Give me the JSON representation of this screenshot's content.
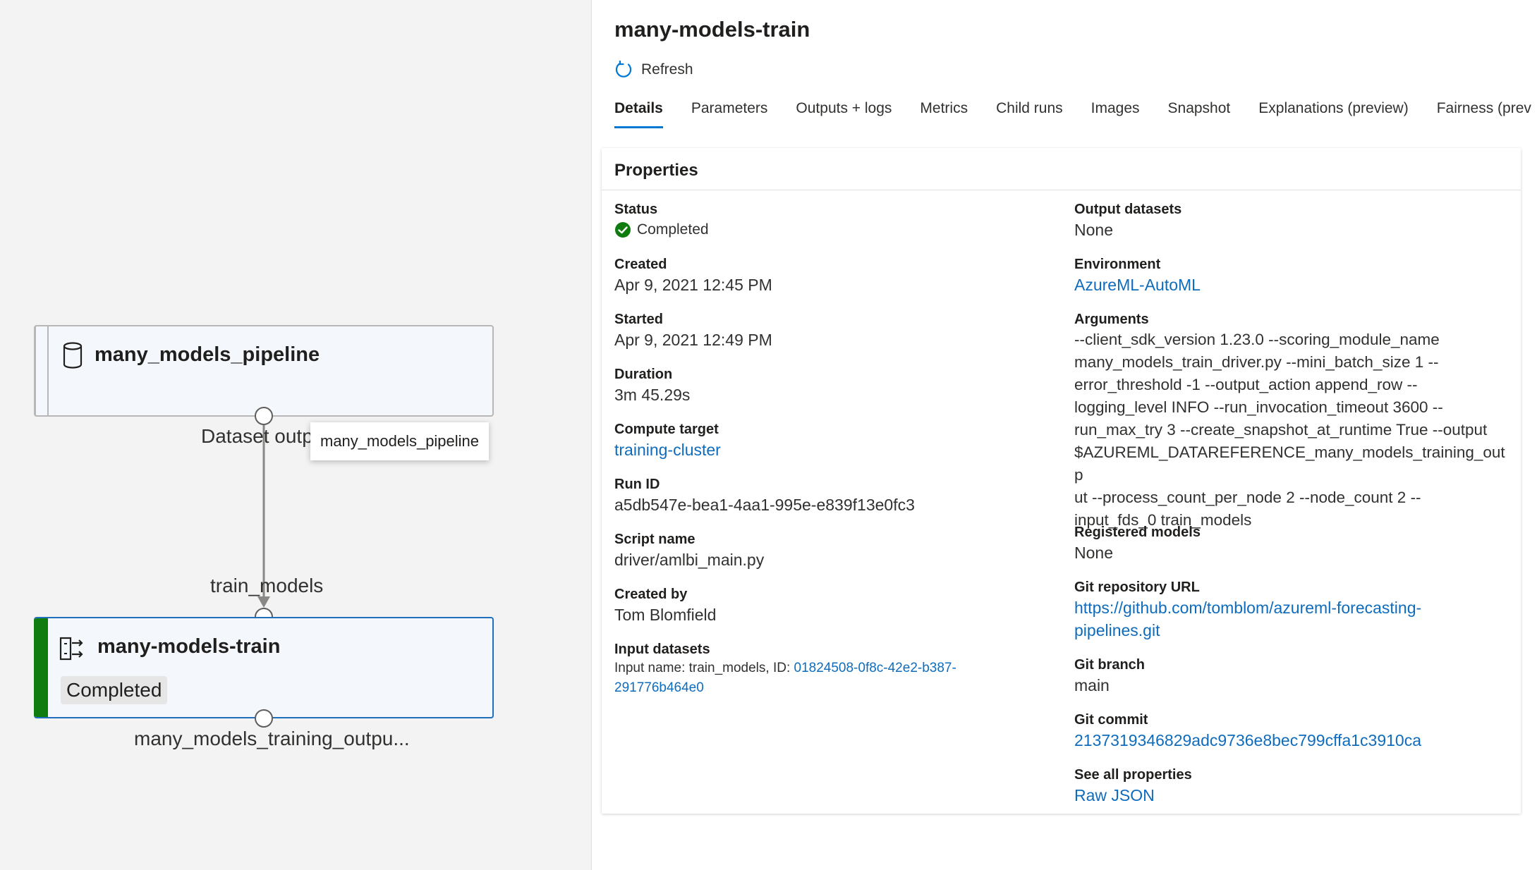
{
  "canvas": {
    "pipeline_node": {
      "title": "many_models_pipeline",
      "output_label": "Dataset outp"
    },
    "train_node": {
      "title": "many-models-train",
      "status": "Completed",
      "input_label": "train_models",
      "output_label": "many_models_training_outpu..."
    },
    "tooltip": "many_models_pipeline"
  },
  "panel": {
    "title": "many-models-train",
    "refresh_label": "Refresh",
    "tabs": [
      "Details",
      "Parameters",
      "Outputs + logs",
      "Metrics",
      "Child runs",
      "Images",
      "Snapshot",
      "Explanations (preview)",
      "Fairness (prev"
    ],
    "active_tab": "Details",
    "properties_title": "Properties",
    "left": {
      "status": {
        "label": "Status",
        "value": "Completed"
      },
      "created": {
        "label": "Created",
        "value": "Apr 9, 2021 12:45 PM"
      },
      "started": {
        "label": "Started",
        "value": "Apr 9, 2021 12:49 PM"
      },
      "duration": {
        "label": "Duration",
        "value": "3m 45.29s"
      },
      "compute": {
        "label": "Compute target",
        "value": "training-cluster"
      },
      "run_id": {
        "label": "Run ID",
        "value": "a5db547e-bea1-4aa1-995e-e839f13e0fc3"
      },
      "script": {
        "label": "Script name",
        "value": "driver/amlbi_main.py"
      },
      "created_by": {
        "label": "Created by",
        "value": "Tom Blomfield"
      },
      "input_datasets": {
        "label": "Input datasets",
        "prefix": "Input name: train_models, ID: ",
        "id_line1": "01824508-0f8c-42e2-b387-",
        "id_line2": "291776b464e0"
      }
    },
    "right": {
      "output_datasets": {
        "label": "Output datasets",
        "value": "None"
      },
      "environment": {
        "label": "Environment",
        "value": "AzureML-AutoML"
      },
      "arguments": {
        "label": "Arguments",
        "lines": [
          "--client_sdk_version 1.23.0 --scoring_module_name",
          "many_models_train_driver.py --mini_batch_size 1 --",
          "error_threshold -1 --output_action append_row --",
          "logging_level INFO --run_invocation_timeout 3600 --",
          "run_max_try 3 --create_snapshot_at_runtime True --output",
          "$AZUREML_DATAREFERENCE_many_models_training_outp",
          "ut --process_count_per_node 2 --node_count 2 --",
          "input_fds_0 train_models"
        ]
      },
      "registered_models": {
        "label": "Registered models",
        "value": "None"
      },
      "git_repo": {
        "label": "Git repository URL",
        "line1": "https://github.com/tomblom/azureml-forecasting-",
        "line2": "pipelines.git"
      },
      "git_branch": {
        "label": "Git branch",
        "value": "main"
      },
      "git_commit": {
        "label": "Git commit",
        "value": "2137319346829adc9736e8bec799cffa1c3910ca"
      },
      "all_props": {
        "label": "See all properties",
        "value": "Raw JSON"
      }
    }
  },
  "colors": {
    "accent": "#0078d4",
    "link": "#0f6cbd",
    "success": "#107c10",
    "canvas_bg": "#f3f3f3"
  }
}
